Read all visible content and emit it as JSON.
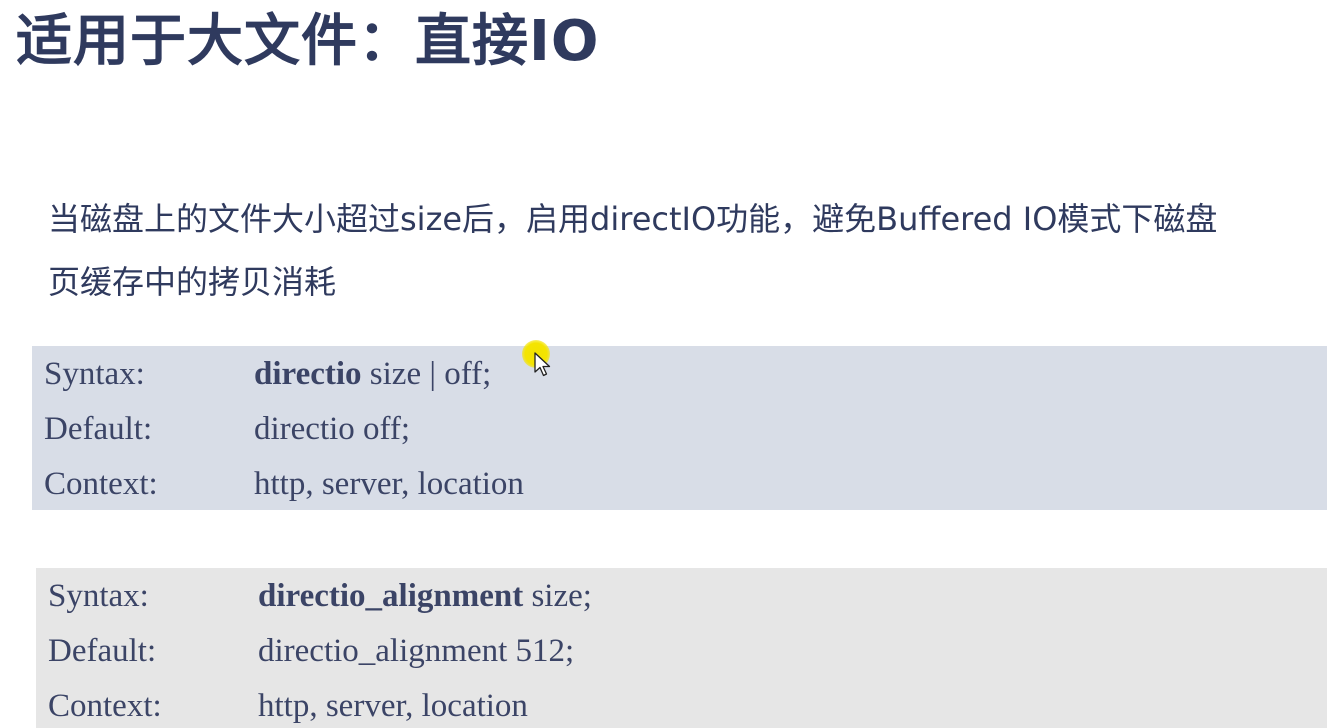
{
  "slide": {
    "title": "适用于大文件：直接IO",
    "description_lines": [
      "当磁盘上的文件大小超过size后，启用directIO功能，避免Buffered IO模式下磁盘",
      "页缓存中的拷贝消耗"
    ]
  },
  "directives": [
    {
      "syntax_label": "Syntax:",
      "syntax_name": "directio",
      "syntax_args": " size | off;",
      "default_label": "Default:",
      "default_value": "directio off;",
      "context_label": "Context:",
      "context_value": "http, server, location",
      "background": "#d8dde7"
    },
    {
      "syntax_label": "Syntax:",
      "syntax_name": "directio_alignment",
      "syntax_args": " size;",
      "default_label": "Default:",
      "default_value": "directio_alignment 512;",
      "context_label": "Context:",
      "context_value": "http, server, location",
      "background": "#e6e6e6"
    }
  ],
  "cursor": {
    "icon": "mouse-pointer-icon",
    "highlight_color": "#f4e400"
  },
  "colors": {
    "title": "#2f3a5e",
    "text": "#3b4466"
  }
}
